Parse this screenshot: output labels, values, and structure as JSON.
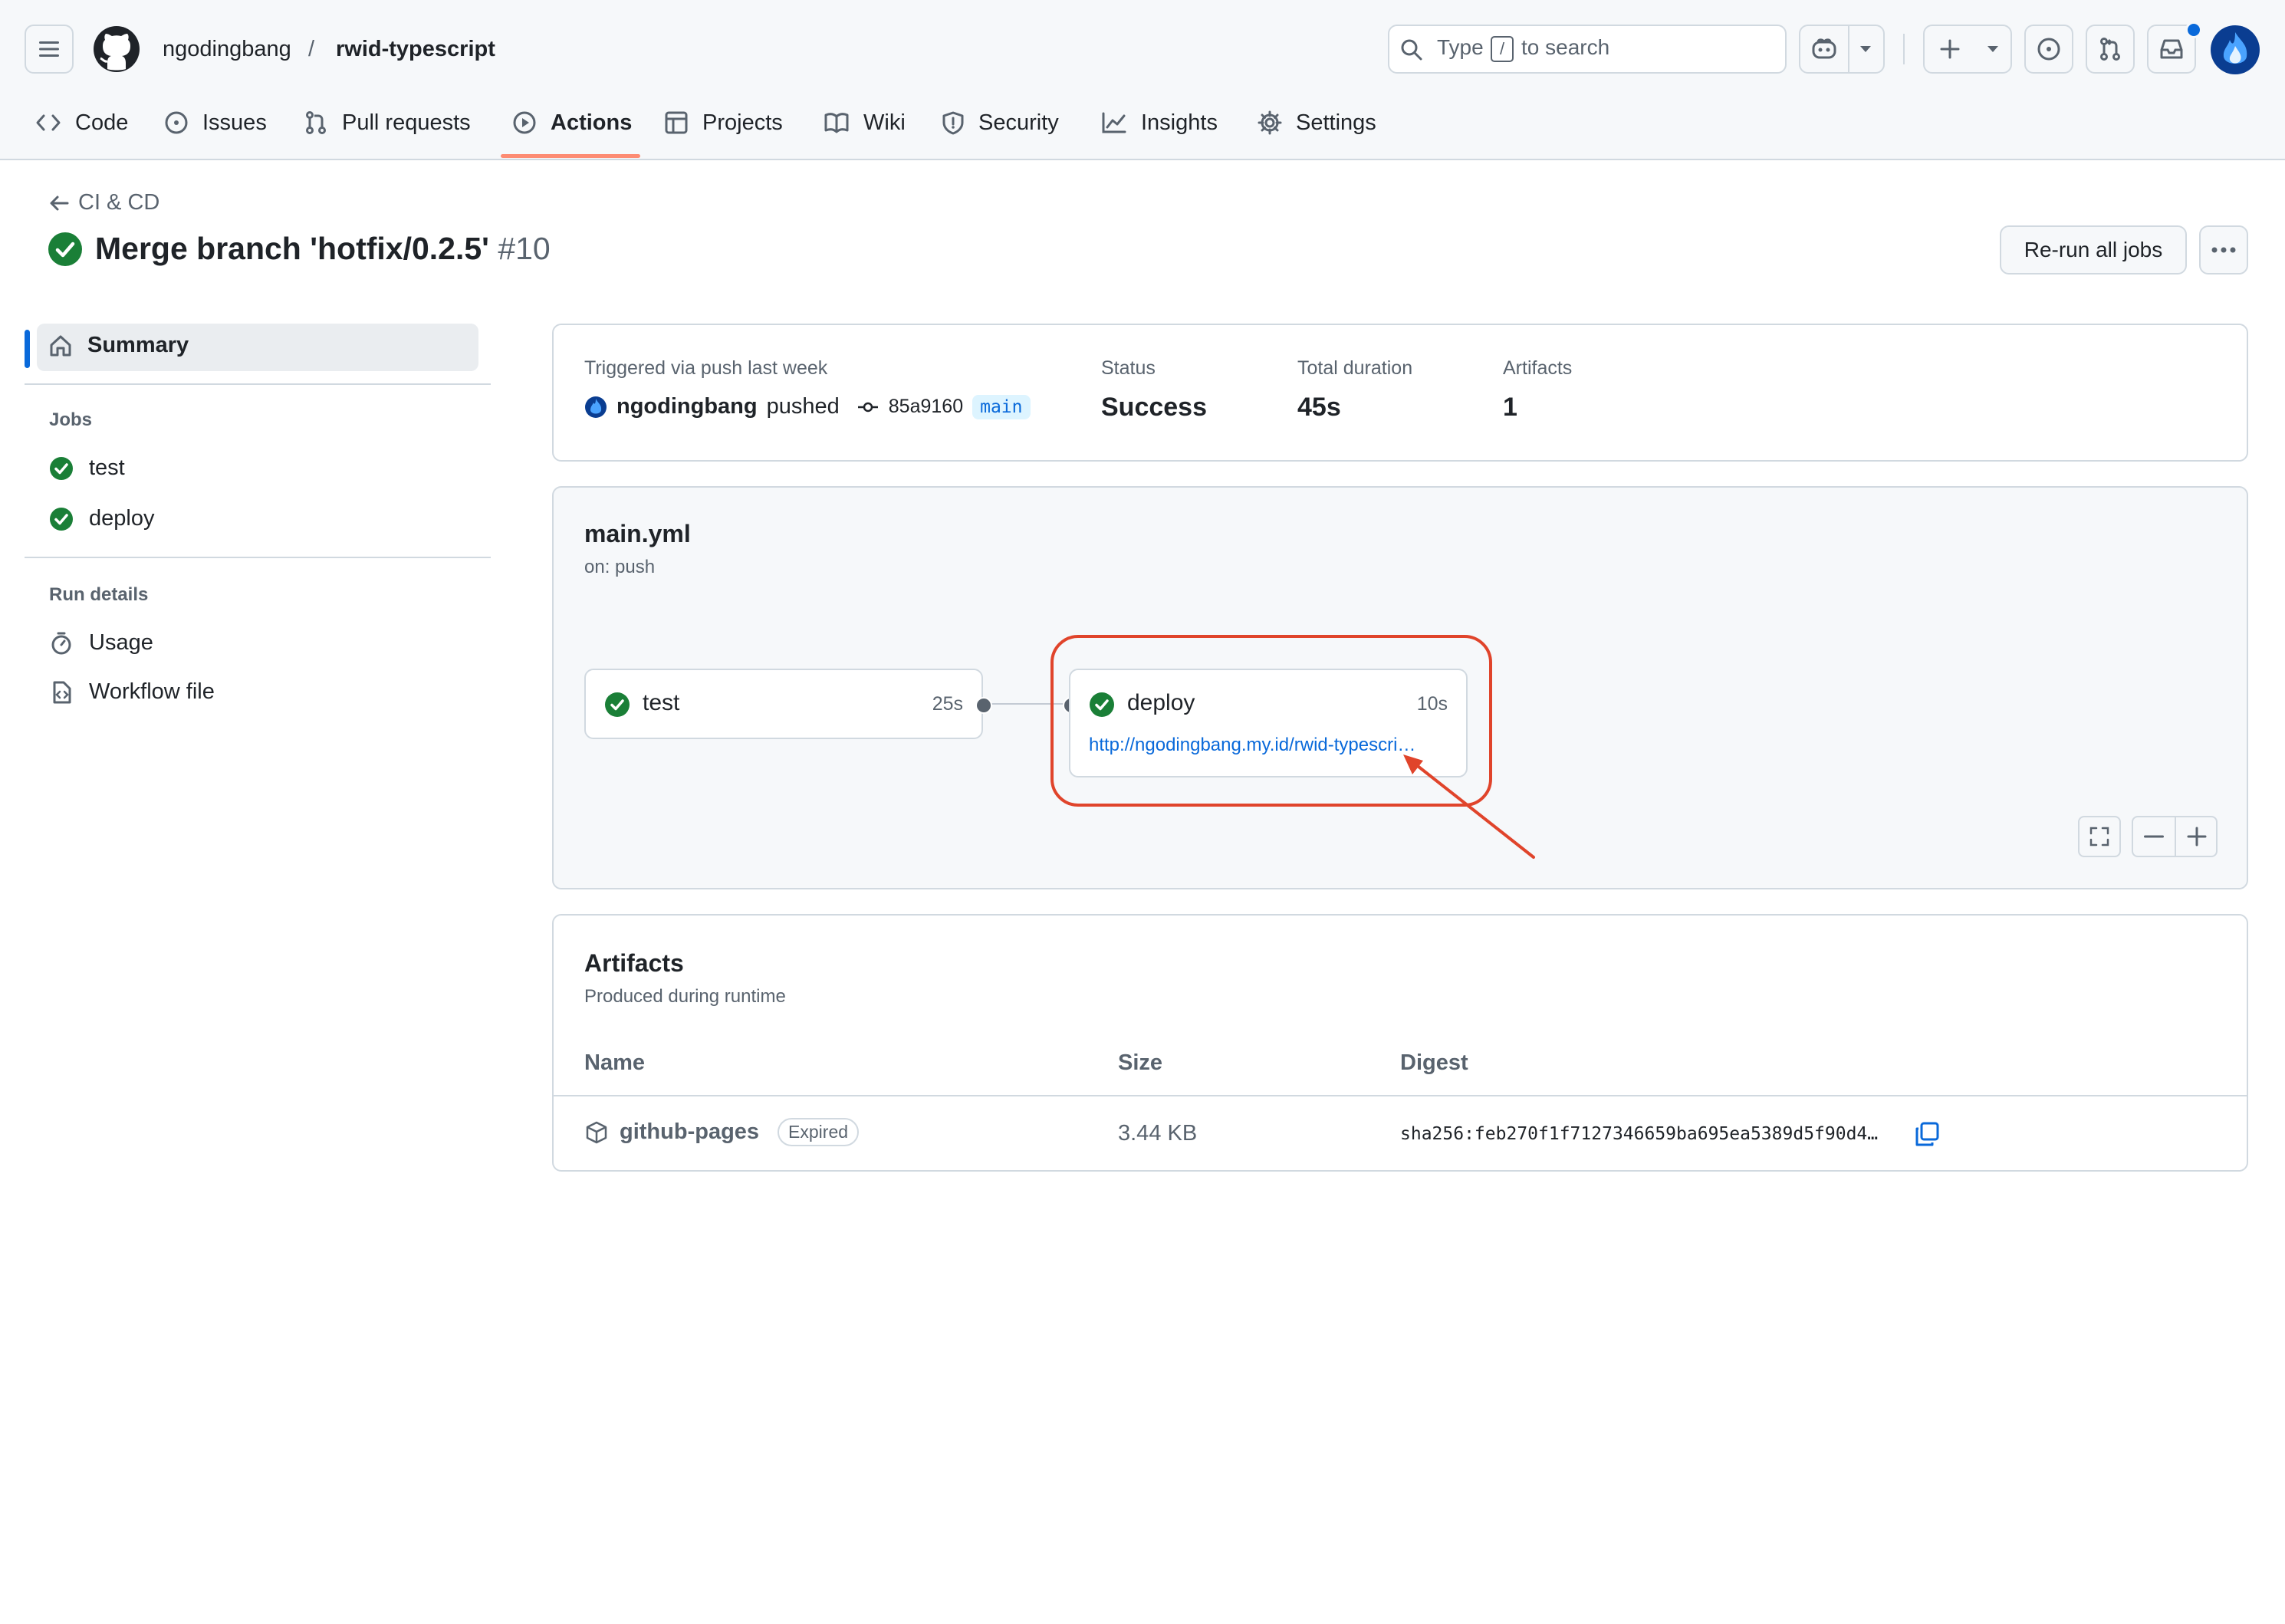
{
  "header": {
    "owner": "ngodingbang",
    "separator": "/",
    "repo": "rwid-typescript",
    "search_placeholder_pre": "Type",
    "search_key": "/",
    "search_placeholder_post": "to search"
  },
  "tabs": [
    {
      "label": "Code",
      "icon": "code-icon"
    },
    {
      "label": "Issues",
      "icon": "issue-icon"
    },
    {
      "label": "Pull requests",
      "icon": "pull-request-icon"
    },
    {
      "label": "Actions",
      "icon": "play-icon",
      "active": true
    },
    {
      "label": "Projects",
      "icon": "table-icon"
    },
    {
      "label": "Wiki",
      "icon": "book-icon"
    },
    {
      "label": "Security",
      "icon": "shield-icon"
    },
    {
      "label": "Insights",
      "icon": "graph-icon"
    },
    {
      "label": "Settings",
      "icon": "gear-icon"
    }
  ],
  "page": {
    "back_label": "CI & CD",
    "title": "Merge branch 'hotfix/0.2.5'",
    "run_number": "#10",
    "rerun_label": "Re-run all jobs"
  },
  "sidebar": {
    "summary": "Summary",
    "jobs_heading": "Jobs",
    "jobs": [
      "test",
      "deploy"
    ],
    "run_details_heading": "Run details",
    "usage": "Usage",
    "workflow_file": "Workflow file"
  },
  "summary_card": {
    "trigger_label": "Triggered via push last week",
    "actor": "ngodingbang",
    "action": "pushed",
    "commit": "85a9160",
    "branch": "main",
    "status_label": "Status",
    "status_value": "Success",
    "duration_label": "Total duration",
    "duration_value": "45s",
    "artifacts_label": "Artifacts",
    "artifacts_value": "1"
  },
  "workflow": {
    "file": "main.yml",
    "trigger": "on: push",
    "jobs": [
      {
        "name": "test",
        "duration": "25s",
        "status": "success"
      },
      {
        "name": "deploy",
        "duration": "10s",
        "status": "success",
        "url": "http://ngodingbang.my.id/rwid-typescri…"
      }
    ]
  },
  "artifacts": {
    "title": "Artifacts",
    "subtitle": "Produced during runtime",
    "columns": [
      "Name",
      "Size",
      "Digest"
    ],
    "rows": [
      {
        "name": "github-pages",
        "badge": "Expired",
        "size": "3.44 KB",
        "digest": "sha256:feb270f1f7127346659ba695ea5389d5f90d4…"
      }
    ]
  },
  "colors": {
    "success": "#1a7f37",
    "accent_underline": "#fd8c73",
    "link": "#0969da",
    "annotation": "#e0442b"
  }
}
